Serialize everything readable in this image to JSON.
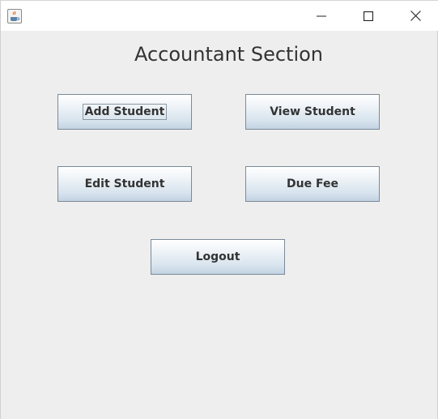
{
  "window": {
    "app_icon": "java-cup-icon",
    "controls": {
      "minimize_icon": "minimize-icon",
      "maximize_icon": "maximize-icon",
      "close_icon": "close-icon"
    }
  },
  "main": {
    "title": "Accountant Section",
    "buttons": {
      "add_student": "Add Student",
      "view_student": "View Student",
      "edit_student": "Edit Student",
      "due_fee": "Due Fee",
      "logout": "Logout"
    }
  },
  "colors": {
    "background": "#eeeeee",
    "titlebar": "#ffffff",
    "button_border": "#7a8a99",
    "button_gradient_top": "#ffffff",
    "button_gradient_bottom": "#c3d3e2",
    "text": "#333333"
  }
}
